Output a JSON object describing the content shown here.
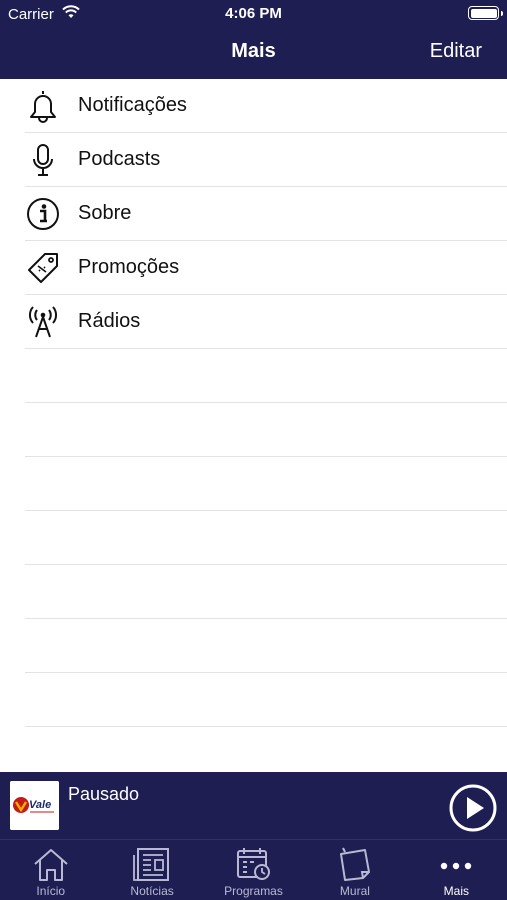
{
  "status_bar": {
    "carrier": "Carrier",
    "time": "4:06 PM"
  },
  "nav": {
    "title": "Mais",
    "edit_label": "Editar"
  },
  "menu": {
    "items": [
      {
        "label": "Notificações",
        "icon": "bell-icon"
      },
      {
        "label": "Podcasts",
        "icon": "microphone-icon"
      },
      {
        "label": "Sobre",
        "icon": "info-icon"
      },
      {
        "label": "Promoções",
        "icon": "tag-icon"
      },
      {
        "label": "Rádios",
        "icon": "antenna-icon"
      }
    ]
  },
  "player": {
    "status": "Pausado",
    "logo_text": "Vale"
  },
  "tabs": [
    {
      "label": "Início",
      "icon": "home-icon"
    },
    {
      "label": "Notícias",
      "icon": "newspaper-icon"
    },
    {
      "label": "Programas",
      "icon": "calendar-clock-icon"
    },
    {
      "label": "Mural",
      "icon": "notes-icon"
    },
    {
      "label": "Mais",
      "icon": "more-icon",
      "active": true
    }
  ],
  "colors": {
    "bar": "#1e1e52",
    "tab_inactive": "#b9b9d6",
    "text": "#111111",
    "separator": "#e3e3e3"
  }
}
